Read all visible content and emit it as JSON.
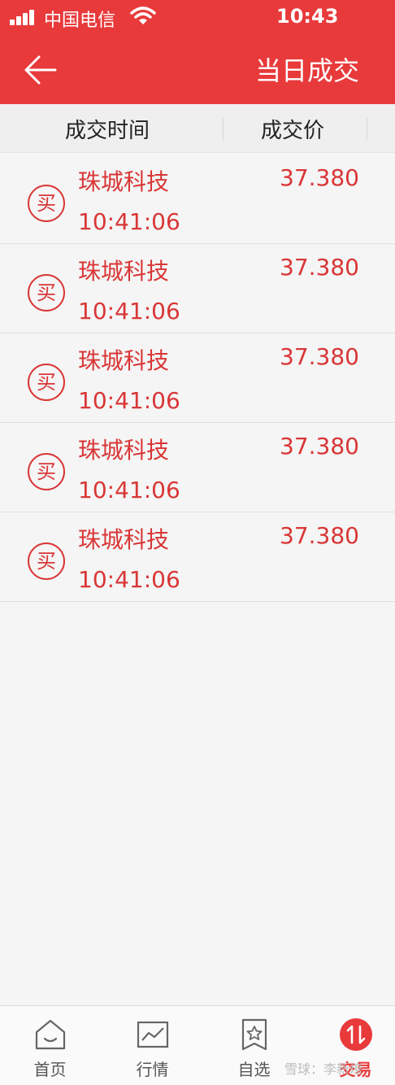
{
  "status": {
    "carrier": "中国电信",
    "time": "10:43"
  },
  "header": {
    "title": "当日成交"
  },
  "columns": {
    "time": "成交时间",
    "price": "成交价"
  },
  "trades": [
    {
      "badge": "买",
      "name": "珠城科技",
      "time": "10:41:06",
      "price": "37.380"
    },
    {
      "badge": "买",
      "name": "珠城科技",
      "time": "10:41:06",
      "price": "37.380"
    },
    {
      "badge": "买",
      "name": "珠城科技",
      "time": "10:41:06",
      "price": "37.380"
    },
    {
      "badge": "买",
      "name": "珠城科技",
      "time": "10:41:06",
      "price": "37.380"
    },
    {
      "badge": "买",
      "name": "珠城科技",
      "time": "10:41:06",
      "price": "37.380"
    }
  ],
  "tabs": [
    {
      "label": "首页",
      "icon": "home-icon"
    },
    {
      "label": "行情",
      "icon": "chart-icon"
    },
    {
      "label": "自选",
      "icon": "bookmark-star-icon"
    },
    {
      "label": "交易",
      "icon": "trade-swap-icon",
      "active": true
    }
  ],
  "watermark": "雪球：李新燎",
  "colors": {
    "brand": "#e83a3b",
    "trade_text": "#d93636"
  }
}
